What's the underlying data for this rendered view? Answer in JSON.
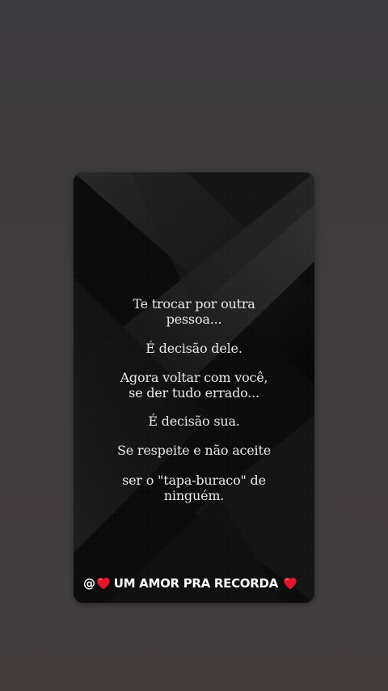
{
  "post": {
    "lines": [
      "Te trocar por outra",
      "pessoa...",
      "É decisão dele.",
      "Agora voltar com você,",
      " se der tudo errado...",
      "É decisão sua.",
      "Se respeite e não aceite",
      "ser o \"tapa-buraco\" de",
      "ninguém."
    ],
    "footer": {
      "at_symbol": "@",
      "text": "UM AMOR PRA RECORDA"
    }
  },
  "icons": {
    "heart": "heart-icon"
  },
  "colors": {
    "background": "#3f3c3e",
    "card": "#0d0d0d",
    "text": "#e9e9e9",
    "heart": "#e1182b"
  }
}
